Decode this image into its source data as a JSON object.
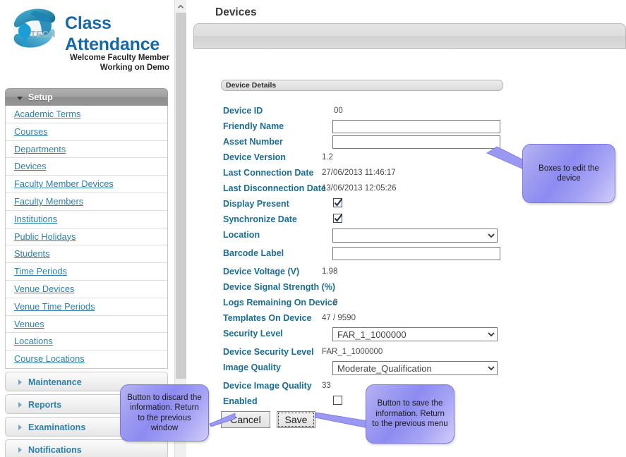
{
  "brand": {
    "logo_icon": "globe-logo-iptech",
    "title_line1": "Class",
    "title_line2": "Attendance",
    "welcome_line1": "Welcome Faculty Member",
    "welcome_line2": "Working on Demo"
  },
  "sidebar": {
    "setup": {
      "label": "Setup",
      "expanded": true,
      "toggle_icon": "chevron-down-icon",
      "items": [
        {
          "label": "Academic Terms"
        },
        {
          "label": "Courses"
        },
        {
          "label": "Departments"
        },
        {
          "label": "Devices"
        },
        {
          "label": "Faculty Member Devices"
        },
        {
          "label": "Faculty Members"
        },
        {
          "label": "Institutions"
        },
        {
          "label": "Public Holidays"
        },
        {
          "label": "Students"
        },
        {
          "label": "Time Periods"
        },
        {
          "label": "Venue Devices"
        },
        {
          "label": "Venue Time Periods"
        },
        {
          "label": "Venues"
        },
        {
          "label": "Locations"
        },
        {
          "label": "Course Locations"
        }
      ]
    },
    "collapsed_sections": [
      {
        "label": "Maintenance",
        "toggle_icon": "chevron-right-icon"
      },
      {
        "label": "Reports",
        "toggle_icon": "chevron-right-icon"
      },
      {
        "label": "Examinations",
        "toggle_icon": "chevron-right-icon"
      },
      {
        "label": "Notifications",
        "toggle_icon": "chevron-right-icon"
      }
    ],
    "scrollbar": {
      "up_icon": "chevron-up-icon"
    }
  },
  "header": {
    "title": "Devices"
  },
  "panel": {
    "legend": "Device Details"
  },
  "form": {
    "device_id": {
      "label": "Device ID",
      "value": "00"
    },
    "friendly_name": {
      "label": "Friendly Name",
      "value": "",
      "placeholder": ""
    },
    "asset_number": {
      "label": "Asset Number",
      "value": "",
      "placeholder": ""
    },
    "device_version": {
      "label": "Device Version",
      "value": "1.2"
    },
    "last_connection_date": {
      "label": "Last Connection Date",
      "value": "27/06/2013 11:46:17"
    },
    "last_disconnection_date": {
      "label": "Last Disconnection Date",
      "value": "13/06/2013 12:05:26"
    },
    "display_present": {
      "label": "Display Present",
      "checked": true
    },
    "synchronize_date": {
      "label": "Synchronize Date",
      "checked": true
    },
    "location": {
      "label": "Location",
      "value": "",
      "options": [
        ""
      ]
    },
    "barcode_label": {
      "label": "Barcode Label",
      "value": "",
      "placeholder": ""
    },
    "device_voltage": {
      "label": "Device Voltage (V)",
      "value": "1.98"
    },
    "device_signal_strength": {
      "label": "Device Signal Strength (%)",
      "value": ""
    },
    "logs_remaining": {
      "label": "Logs Remaining On Device",
      "value": "0"
    },
    "templates_on_device": {
      "label": "Templates On Device",
      "value": "47 / 9590"
    },
    "security_level": {
      "label": "Security Level",
      "value": "FAR_1_1000000",
      "options": [
        "FAR_1_1000000"
      ]
    },
    "device_security_level": {
      "label": "Device Security Level",
      "value": "FAR_1_1000000"
    },
    "image_quality": {
      "label": "Image Quality",
      "value": "Moderate_Qualification",
      "options": [
        "Moderate_Qualification"
      ]
    },
    "device_image_quality": {
      "label": "Device Image Quality",
      "value": "33"
    },
    "enabled": {
      "label": "Enabled",
      "checked": false
    }
  },
  "actions": {
    "cancel_label": "Cancel",
    "save_label": "Save"
  },
  "callouts": {
    "edit_boxes": "Boxes to edit the device",
    "cancel": "Button to discard the information. Return to the previous window",
    "save": "Button to save the information. Return to the previous menu"
  },
  "colors": {
    "label_teal": "#1b6d94",
    "link_blue": "#2f7fa8",
    "brand_blue": "#1769a5",
    "callout_purple": "#8d8bf0",
    "panel_gray": "#9a9a9a"
  }
}
